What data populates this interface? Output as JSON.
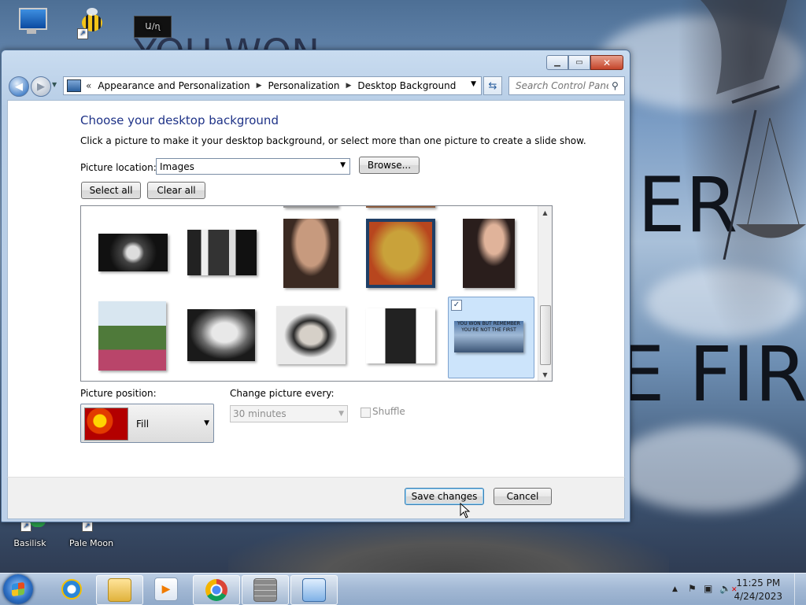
{
  "desktop": {
    "icons": [
      {
        "label": "",
        "name": "computer"
      },
      {
        "label": "",
        "name": "bee-shortcut"
      },
      {
        "label": "",
        "name": "terminal-shortcut"
      },
      {
        "label": "Basilisk",
        "name": "basilisk"
      },
      {
        "label": "Pale Moon",
        "name": "pale-moon"
      }
    ],
    "wallpaper_text": [
      "YOU WON",
      "ER",
      "E FIR"
    ]
  },
  "window": {
    "breadcrumbs": [
      "Appearance and Personalization",
      "Personalization",
      "Desktop Background"
    ],
    "breadcrumb_prefix": "«",
    "search_placeholder": "Search Control Panel",
    "title": "Choose your desktop background",
    "description": "Click a picture to make it your desktop background, or select more than one picture to create a slide show.",
    "picture_location_label": "Picture location:",
    "picture_location_value": "Images",
    "browse_label": "Browse...",
    "select_all_label": "Select all",
    "clear_all_label": "Clear all",
    "picture_position_label": "Picture position:",
    "picture_position_value": "Fill",
    "change_every_label": "Change picture every:",
    "change_every_value": "30 minutes",
    "shuffle_label": "Shuffle",
    "shuffle_checked": false,
    "selected_thumb_text": "YOU WON BUT REMEMBER YOU'RE NOT THE FIRST",
    "save_label": "Save changes",
    "cancel_label": "Cancel"
  },
  "taskbar": {
    "time": "11:25 PM",
    "date": "4/24/2023",
    "apps": [
      "internet-explorer",
      "file-explorer",
      "media-player",
      "chrome",
      "firewall",
      "control-panel"
    ]
  }
}
